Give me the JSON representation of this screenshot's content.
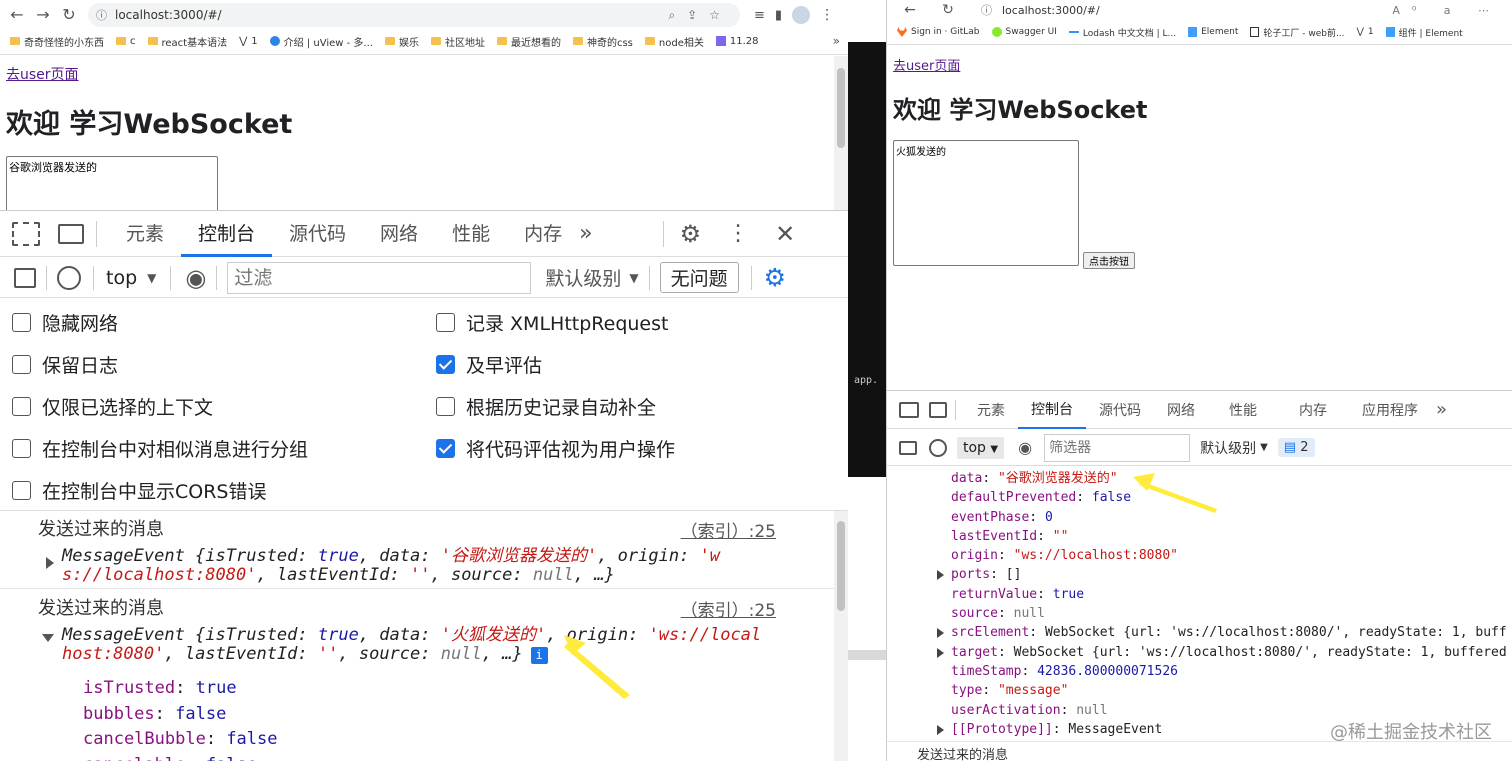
{
  "left": {
    "url": "localhost:3000/#/",
    "bookmarks": [
      "奇奇怪怪的小东西",
      "c",
      "react基本语法",
      "1",
      "介绍 | uView - 多...",
      "娱乐",
      "社区地址",
      "最近想看的",
      "神奇的css",
      "node相关",
      "11.28"
    ],
    "page": {
      "link": "去user页面",
      "heading": "欢迎 学习WebSocket",
      "textarea_value": "谷歌浏览器发送的"
    },
    "devtools": {
      "tabs": [
        "元素",
        "控制台",
        "源代码",
        "网络",
        "性能",
        "内存"
      ],
      "active_tab": "控制台",
      "context": "top",
      "filter_placeholder": "过滤",
      "level": "默认级别",
      "issues": "无问题",
      "settings": [
        {
          "label": "隐藏网络",
          "checked": false
        },
        {
          "label": "记录 XMLHttpRequest",
          "checked": false
        },
        {
          "label": "保留日志",
          "checked": false
        },
        {
          "label": "及早评估",
          "checked": true
        },
        {
          "label": "仅限已选择的上下文",
          "checked": false
        },
        {
          "label": "根据历史记录自动补全",
          "checked": false
        },
        {
          "label": "在控制台中对相似消息进行分组",
          "checked": false
        },
        {
          "label": "将代码评估视为用户操作",
          "checked": true
        },
        {
          "label": "在控制台中显示CORS错误",
          "checked": false
        }
      ],
      "log1": {
        "title": "发送过来的消息",
        "source": "（索引）:25",
        "line1_a": "MessageEvent {isTrusted: ",
        "line1_b": "true",
        "line1_c": ", data: ",
        "line1_d": "'谷歌浏览器发送的'",
        "line1_e": ", origin: ",
        "line1_f": "'w",
        "line2_a": "s://localhost:8080'",
        "line2_b": ", lastEventId: ",
        "line2_c": "''",
        "line2_d": ", source: ",
        "line2_e": "null",
        "line2_f": ", …}"
      },
      "log2": {
        "title": "发送过来的消息",
        "source": "（索引）:25",
        "line1_a": "MessageEvent {isTrusted: ",
        "line1_b": "true",
        "line1_c": ", data: ",
        "line1_d": "'火狐发送的'",
        "line1_e": ", origin: ",
        "line1_f": "'ws://local",
        "line2_a": "host:8080'",
        "line2_b": ", lastEventId: ",
        "line2_c": "''",
        "line2_d": ", source: ",
        "line2_e": "null",
        "line2_f": ", …}",
        "info": "i",
        "props": [
          {
            "k": "isTrusted",
            "v": "true"
          },
          {
            "k": "bubbles",
            "v": "false"
          },
          {
            "k": "cancelBubble",
            "v": "false"
          },
          {
            "k": "cancelable",
            "v": "false"
          }
        ]
      }
    }
  },
  "gap": {
    "text": "app."
  },
  "right": {
    "url": "localhost:3000/#/",
    "bookmarks": [
      "Sign in · GitLab",
      "Swagger UI",
      "Lodash 中文文档 | L...",
      "Element",
      "轮子工厂 - web前...",
      "1",
      "组件 | Element"
    ],
    "page": {
      "link": "去user页面",
      "heading": "欢迎 学习WebSocket",
      "textarea_value": "火狐发送的",
      "button": "点击按钮"
    },
    "devtools": {
      "tabs": [
        "元素",
        "控制台",
        "源代码",
        "网络",
        "性能",
        "内存",
        "应用程序"
      ],
      "active_tab": "控制台",
      "context": "top",
      "filter_placeholder": "筛选器",
      "level": "默认级别",
      "count": "2",
      "props": [
        {
          "k": "data",
          "v": "\"谷歌浏览器发送的\"",
          "t": "str",
          "exp": false
        },
        {
          "k": "defaultPrevented",
          "v": "false",
          "t": "kw",
          "exp": false
        },
        {
          "k": "eventPhase",
          "v": "0",
          "t": "kw",
          "exp": false
        },
        {
          "k": "lastEventId",
          "v": "\"\"",
          "t": "str",
          "exp": false
        },
        {
          "k": "origin",
          "v": "\"ws://localhost:8080\"",
          "t": "str",
          "exp": false
        },
        {
          "k": "ports",
          "v": "[]",
          "t": "plain",
          "exp": true
        },
        {
          "k": "returnValue",
          "v": "true",
          "t": "kw",
          "exp": false
        },
        {
          "k": "source",
          "v": "null",
          "t": "null",
          "exp": false
        },
        {
          "k": "srcElement",
          "v": "WebSocket {url: 'ws://localhost:8080/', readyState: 1, buff",
          "t": "plain",
          "exp": true
        },
        {
          "k": "target",
          "v": "WebSocket {url: 'ws://localhost:8080/', readyState: 1, buffered",
          "t": "plain",
          "exp": true
        },
        {
          "k": "timeStamp",
          "v": "42836.800000071526",
          "t": "kw",
          "exp": false
        },
        {
          "k": "type",
          "v": "\"message\"",
          "t": "str",
          "exp": false
        },
        {
          "k": "userActivation",
          "v": "null",
          "t": "null",
          "exp": false
        },
        {
          "k": "[[Prototype]]",
          "v": "MessageEvent",
          "t": "plain",
          "exp": true
        }
      ],
      "footer_log": "发送过来的消息"
    }
  },
  "watermark": "@稀土掘金技术社区"
}
